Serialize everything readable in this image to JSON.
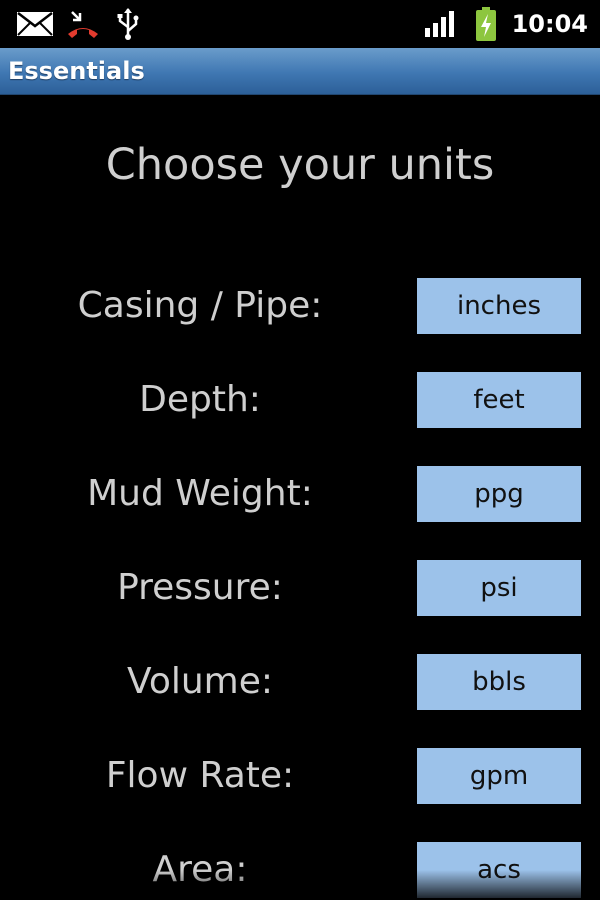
{
  "status_bar": {
    "time": "10:04",
    "icons": [
      "mail-icon",
      "missed-call-icon",
      "usb-icon",
      "signal-icon",
      "battery-charging-icon"
    ]
  },
  "app": {
    "title": "Essentials"
  },
  "heading": "Choose your units",
  "units": [
    {
      "label": "Casing / Pipe:",
      "value": "inches"
    },
    {
      "label": "Depth:",
      "value": "feet"
    },
    {
      "label": "Mud Weight:",
      "value": "ppg"
    },
    {
      "label": "Pressure:",
      "value": "psi"
    },
    {
      "label": "Volume:",
      "value": "bbls"
    },
    {
      "label": "Flow Rate:",
      "value": "gpm"
    },
    {
      "label": "Area:",
      "value": "acs"
    }
  ],
  "colors": {
    "background": "#000000",
    "title_bar": "#3f77b2",
    "label_text": "#cfcfcf",
    "button_bg": "#9cc2ea",
    "battery": "#8dc63f",
    "missed_call": "#e23b2e"
  }
}
